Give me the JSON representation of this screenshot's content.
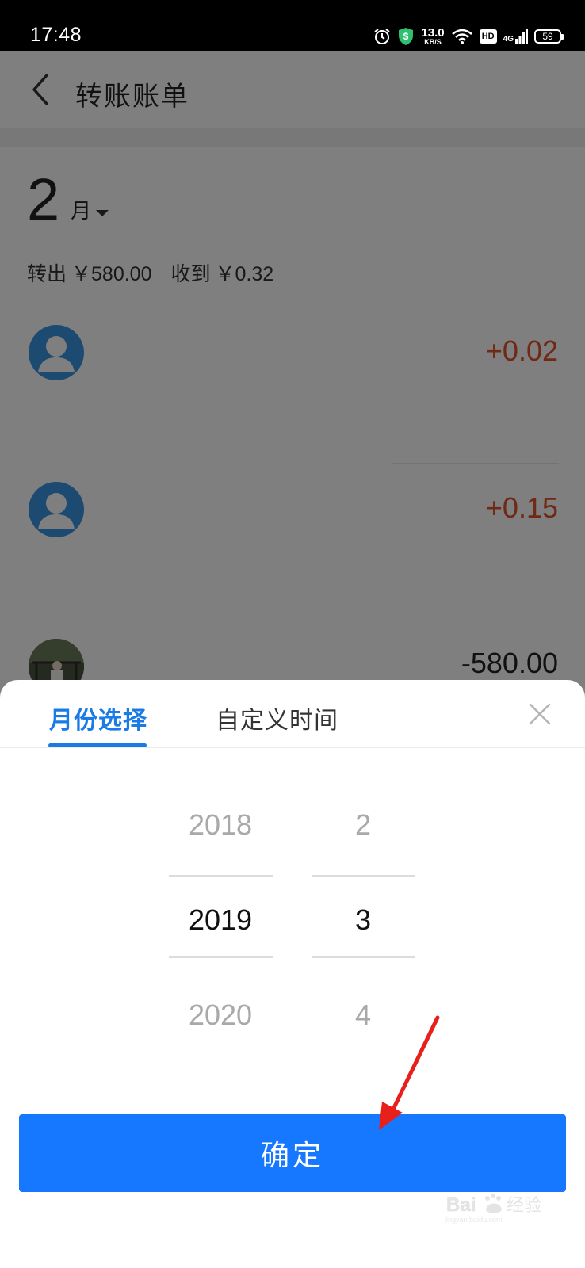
{
  "status_bar": {
    "time": "17:48",
    "net_speed_value": "13.0",
    "net_speed_unit": "KB/S",
    "hd_label": "HD",
    "network_type": "4G",
    "battery_level": "59"
  },
  "header": {
    "title": "转账账单"
  },
  "summary": {
    "month_number": "2",
    "month_unit": "月",
    "out_label": "转出",
    "out_amount": "￥580.00",
    "in_label": "收到",
    "in_amount": "￥0.32"
  },
  "transactions": [
    {
      "amount": "+0.02",
      "direction": "in",
      "avatar": "default-user-icon"
    },
    {
      "amount": "+0.15",
      "direction": "in",
      "avatar": "default-user-icon"
    },
    {
      "amount": "-580.00",
      "direction": "out",
      "avatar": "user-photo"
    }
  ],
  "sheet": {
    "tab_month": "月份选择",
    "tab_custom": "自定义时间",
    "years": [
      "2018",
      "2019",
      "2020"
    ],
    "months": [
      "2",
      "3",
      "4"
    ],
    "selected_year": "2019",
    "selected_month": "3",
    "confirm_label": "确定"
  },
  "watermark": {
    "brand": "Bai",
    "cn": "经验",
    "site": "jingyan.baidu.com"
  },
  "colors": {
    "accent": "#1677ff",
    "positive_amount": "#e0532b",
    "annotation": "#e8201c"
  }
}
